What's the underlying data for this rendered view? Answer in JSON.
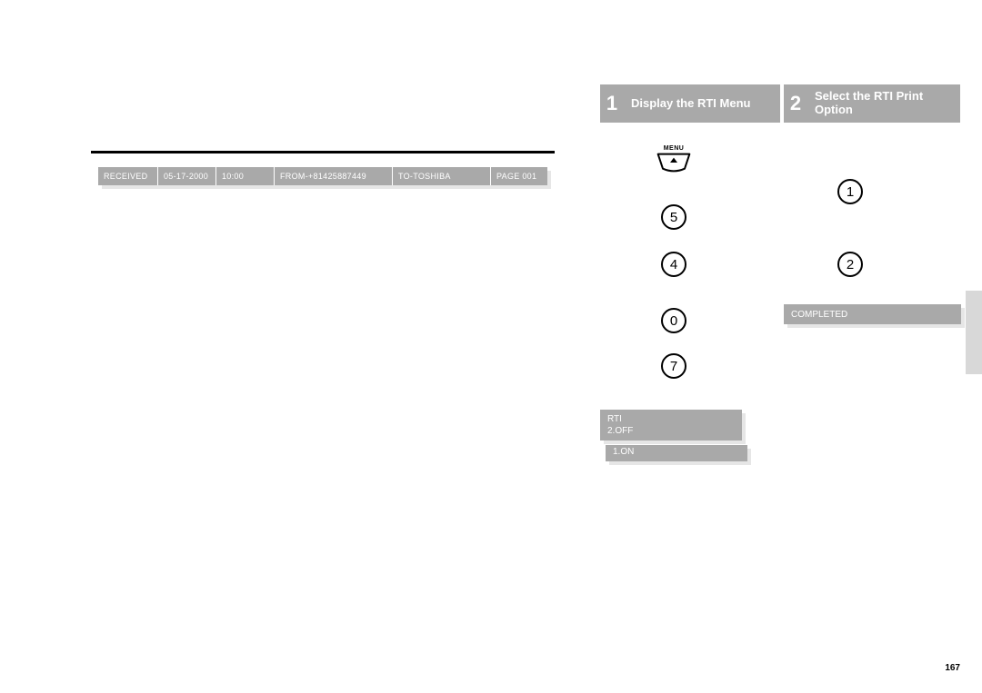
{
  "fax_header": {
    "received_label": "RECEIVED",
    "date": "05-17-2000",
    "time": "10:00",
    "from": "FROM-+81425887449",
    "to": "TO-TOSHIBA",
    "page": "PAGE 001"
  },
  "steps": {
    "s1": {
      "num": "1",
      "label": "Display the RTI Menu"
    },
    "s2": {
      "num": "2",
      "label": "Select the RTI Print Option"
    }
  },
  "menu_button_label": "MENU",
  "keys": {
    "k5": "5",
    "k4": "4",
    "k0": "0",
    "k7": "7",
    "r1": "1",
    "r2": "2"
  },
  "lcd": {
    "rti_line1": "RTI",
    "rti_line2": "2.OFF",
    "on": "1.ON",
    "completed": "COMPLETED"
  },
  "page_number": "167"
}
